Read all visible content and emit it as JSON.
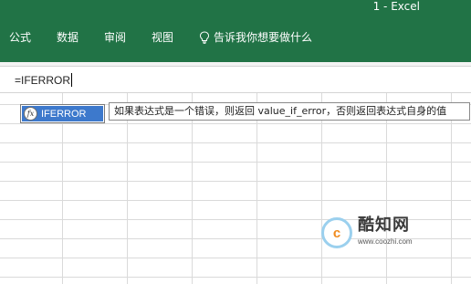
{
  "app": {
    "title": "1  -  Excel"
  },
  "ribbon": {
    "tabs": [
      {
        "label": "公式"
      },
      {
        "label": "数据"
      },
      {
        "label": "审阅"
      },
      {
        "label": "视图"
      }
    ],
    "tell_me": {
      "label": "告诉我你想要做什么",
      "icon": "lightbulb-icon"
    },
    "colors": {
      "background": "#217346",
      "text": "#ffffff"
    }
  },
  "formula_bar": {
    "value": "=IFERROR"
  },
  "autocomplete": {
    "item": {
      "label": "IFERROR",
      "icon": "function-icon"
    },
    "highlight_color": "#3d79cc"
  },
  "tooltip": {
    "text": "如果表达式是一个错误，则返回 value_if_error，否则返回表达式自身的值"
  },
  "watermark": {
    "name": "酷知网",
    "url": "www.coozhi.com"
  }
}
